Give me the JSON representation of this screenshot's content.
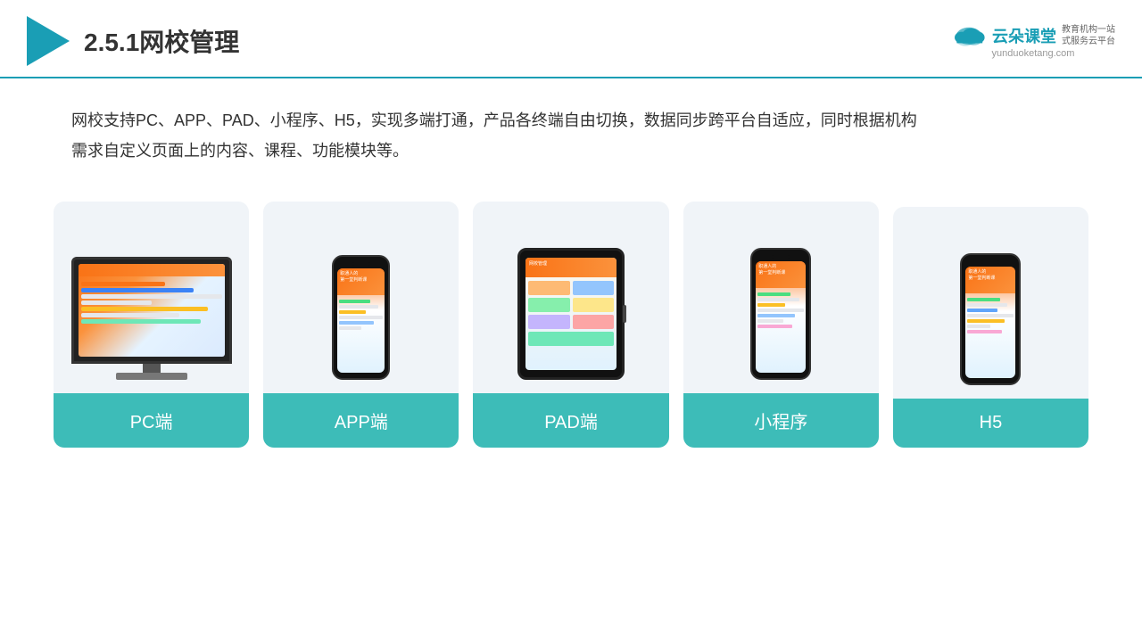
{
  "header": {
    "title": "2.5.1网校管理",
    "brand": {
      "name": "云朵课堂",
      "url": "yunduoketang.com",
      "tagline": "教育机构一站\n式服务云平台"
    }
  },
  "description": {
    "text": "网校支持PC、APP、PAD、小程序、H5，实现多端打通，产品各终端自由切换，数据同步跨平台自适应，同时根据机构需求自定义页面上的内容、课程、功能模块等。"
  },
  "cards": [
    {
      "id": "pc",
      "label": "PC端",
      "device": "pc"
    },
    {
      "id": "app",
      "label": "APP端",
      "device": "phone"
    },
    {
      "id": "pad",
      "label": "PAD端",
      "device": "tablet"
    },
    {
      "id": "miniapp",
      "label": "小程序",
      "device": "phone2"
    },
    {
      "id": "h5",
      "label": "H5",
      "device": "phone3"
    }
  ],
  "colors": {
    "accent": "#3dbcb8",
    "header_line": "#1a9eb5",
    "triangle": "#1a9eb5"
  }
}
